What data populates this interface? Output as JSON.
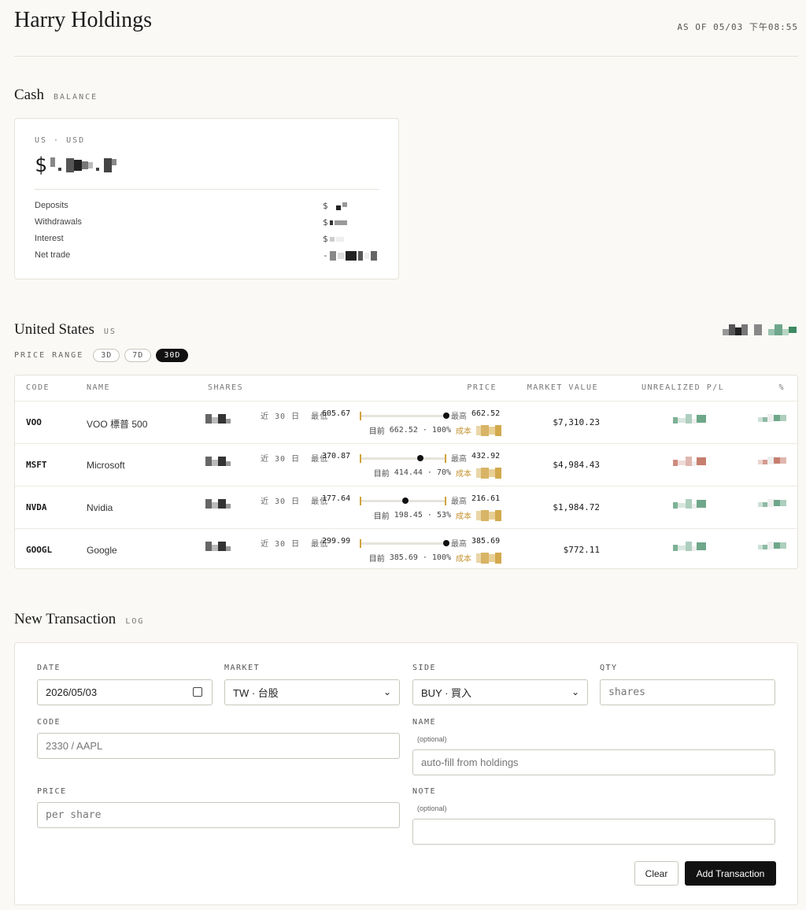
{
  "header": {
    "title": "Harry Holdings",
    "as_of": "AS OF 05/03 下午08:55"
  },
  "cash": {
    "title": "Cash",
    "subtitle": "BALANCE",
    "region": "US · USD",
    "currency_symbol": "$",
    "rows": [
      {
        "label": "Deposits",
        "prefix": "$"
      },
      {
        "label": "Withdrawals",
        "prefix": "$"
      },
      {
        "label": "Interest",
        "prefix": "$"
      },
      {
        "label": "Net trade",
        "prefix": "-"
      }
    ]
  },
  "us": {
    "title": "United States",
    "subtitle": "US",
    "range_label": "PRICE RANGE",
    "ranges": [
      "3D",
      "7D",
      "30D"
    ],
    "active_range": "30D",
    "columns": [
      "CODE",
      "NAME",
      "SHARES",
      "PRICE",
      "MARKET VALUE",
      "UNREALIZED P/L",
      "%"
    ],
    "range_prefix": "近 30 日",
    "low_label": "最低",
    "high_label": "最高",
    "current_label": "目前",
    "cost_label": "成本",
    "holdings": [
      {
        "code": "VOO",
        "name": "VOO 標普 500",
        "low": "605.67",
        "high": "662.52",
        "current": "662.52",
        "pct": "100%",
        "position": 1.0,
        "market_value": "$7,310.23",
        "pl_color": "#5e9d7d"
      },
      {
        "code": "MSFT",
        "name": "Microsoft",
        "low": "370.87",
        "high": "432.92",
        "current": "414.44",
        "pct": "70%",
        "position": 0.7,
        "market_value": "$4,984.43",
        "pl_color": "#c0705f"
      },
      {
        "code": "NVDA",
        "name": "Nvidia",
        "low": "177.64",
        "high": "216.61",
        "current": "198.45",
        "pct": "53%",
        "position": 0.53,
        "market_value": "$1,984.72",
        "pl_color": "#5e9d7d"
      },
      {
        "code": "GOOGL",
        "name": "Google",
        "low": "299.99",
        "high": "385.69",
        "current": "385.69",
        "pct": "100%",
        "position": 1.0,
        "market_value": "$772.11",
        "pl_color": "#5e9d7d"
      }
    ]
  },
  "transaction": {
    "title": "New Transaction",
    "subtitle": "LOG",
    "date_label": "DATE",
    "date_value": "2026/05/03",
    "market_label": "MARKET",
    "market_value": "TW · 台股",
    "side_label": "SIDE",
    "side_value": "BUY · 買入",
    "qty_label": "QTY",
    "qty_placeholder": "shares",
    "code_label": "CODE",
    "code_placeholder": "2330 / AAPL",
    "name_label": "NAME",
    "name_optional": "(optional)",
    "name_placeholder": "auto-fill from holdings",
    "price_label": "PRICE",
    "price_placeholder": "per share",
    "note_label": "NOTE",
    "note_optional": "(optional)",
    "clear_label": "Clear",
    "add_label": "Add Transaction"
  },
  "colors": {
    "accent": "#111111",
    "cost": "#c4922e",
    "gain": "#5e9d7d",
    "loss": "#c0705f"
  }
}
